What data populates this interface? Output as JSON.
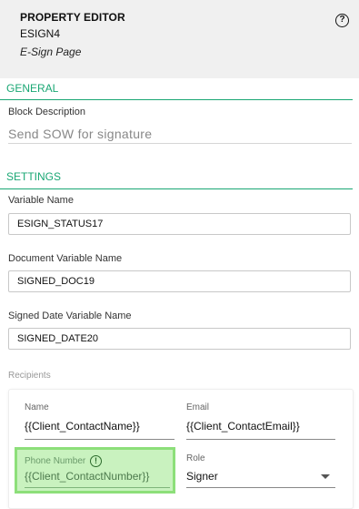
{
  "header": {
    "title": "PROPERTY EDITOR",
    "block_id": "ESIGN4",
    "page_type": "E-Sign Page",
    "help_glyph": "?"
  },
  "general": {
    "section_title": "GENERAL",
    "block_description_label": "Block Description",
    "block_description_value": "Send SOW for signature"
  },
  "settings": {
    "section_title": "SETTINGS",
    "variable_name_label": "Variable Name",
    "variable_name_value": "ESIGN_STATUS17",
    "document_variable_label": "Document Variable Name",
    "document_variable_value": "SIGNED_DOC19",
    "signed_date_label": "Signed Date Variable Name",
    "signed_date_value": "SIGNED_DATE20"
  },
  "recipients": {
    "label": "Recipients",
    "name_label": "Name",
    "name_value": "{{Client_ContactName}}",
    "email_label": "Email",
    "email_value": "{{Client_ContactEmail}}",
    "phone_label": "Phone Number",
    "phone_value": "{{Client_ContactNumber}}",
    "role_label": "Role",
    "role_value": "Signer",
    "warning_glyph": "!"
  },
  "colors": {
    "accent": "#1aa774",
    "header_bg": "#f0f0f0",
    "highlight": "#c9f2bf",
    "highlight_border": "#8ddf7a"
  }
}
